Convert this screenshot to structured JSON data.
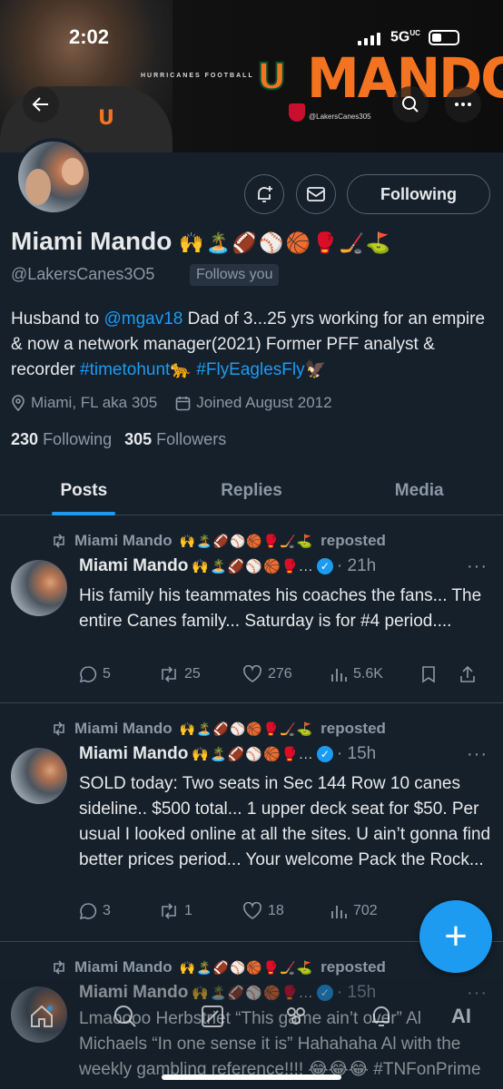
{
  "status_bar": {
    "time": "2:02",
    "network": "5G",
    "network_sup": "UC"
  },
  "banner": {
    "subtitle": "HURRICANES FOOTBALL",
    "logo_letter": "U",
    "title": "MANDO",
    "handle_tag": "@LakersCanes305"
  },
  "header": {
    "back_icon": "back-arrow-icon",
    "search_icon": "search-icon",
    "more_icon": "more-icon"
  },
  "profile": {
    "name": "Miami Mando",
    "name_emojis": "🙌🏝️🏈⚾🏀🥊🏒⛳",
    "handle": "@LakersCanes3O5",
    "follows_you": "Follows you",
    "following_label": "Following",
    "bio_part1": "Husband to ",
    "bio_mention": "@mgav18",
    "bio_part2": " Dad of 3...25 yrs working for an empire & now a network manager(2021) Former PFF analyst & recorder ",
    "bio_tag1": "#timetohunt",
    "bio_tag1_emoji": "🐆",
    "bio_tag2": "#FlyEaglesFly",
    "bio_tag2_emoji": "🦅",
    "location": "Miami, FL aka 305",
    "joined": "Joined August 2012",
    "following_count": "230",
    "following_label_text": "Following",
    "followers_count": "305",
    "followers_label_text": "Followers"
  },
  "tabs": [
    {
      "label": "Posts",
      "active": true
    },
    {
      "label": "Replies",
      "active": false
    },
    {
      "label": "Media",
      "active": false
    }
  ],
  "posts": [
    {
      "repost_by": "Miami Mando",
      "repost_emojis": "🙌🏝️🏈⚾🏀🥊🏒⛳",
      "repost_suffix": "reposted",
      "author": "Miami Mando",
      "author_emojis": "🙌🏝️🏈⚾🏀🥊...",
      "time": "· 21h",
      "text": "His family his teammates his coaches the fans... The entire Canes family... Saturday is for #4 period....",
      "replies": "5",
      "reposts": "25",
      "likes": "276",
      "views": "5.6K"
    },
    {
      "repost_by": "Miami Mando",
      "repost_emojis": "🙌🏝️🏈⚾🏀🥊🏒⛳",
      "repost_suffix": "reposted",
      "author": "Miami Mando",
      "author_emojis": "🙌🏝️🏈⚾🏀🥊...",
      "time": "· 15h",
      "text": "SOLD today: Two seats in Sec 144 Row 10 canes sideline.. $500 total... 1 upper deck seat for $50. Per usual I looked online at all the sites. U ain’t gonna find better prices period... Your welcome Pack the Rock...",
      "replies": "3",
      "reposts": "1",
      "likes": "18",
      "views": "702"
    },
    {
      "repost_by": "Miami Mando",
      "repost_emojis": "🙌🏝️🏈⚾🏀🥊🏒⛳",
      "repost_suffix": "reposted",
      "author": "Miami Mando",
      "author_emojis": "🙌🏝️🏈⚾🏀🥊...",
      "time": "· 15h",
      "text": "Lmaoooo Herbstriet “This game ain’t over” Al Michaels “In one sense it is” Hahahaha Al with the weekly gambling reference!!!! 😂😂😂 #TNFonPrime"
    }
  ],
  "fab": {
    "label": "+"
  },
  "nav": [
    "home-icon",
    "search-icon",
    "grok-icon",
    "communities-icon",
    "notifications-icon",
    "ai-icon"
  ],
  "nav_ai_label": "AI"
}
